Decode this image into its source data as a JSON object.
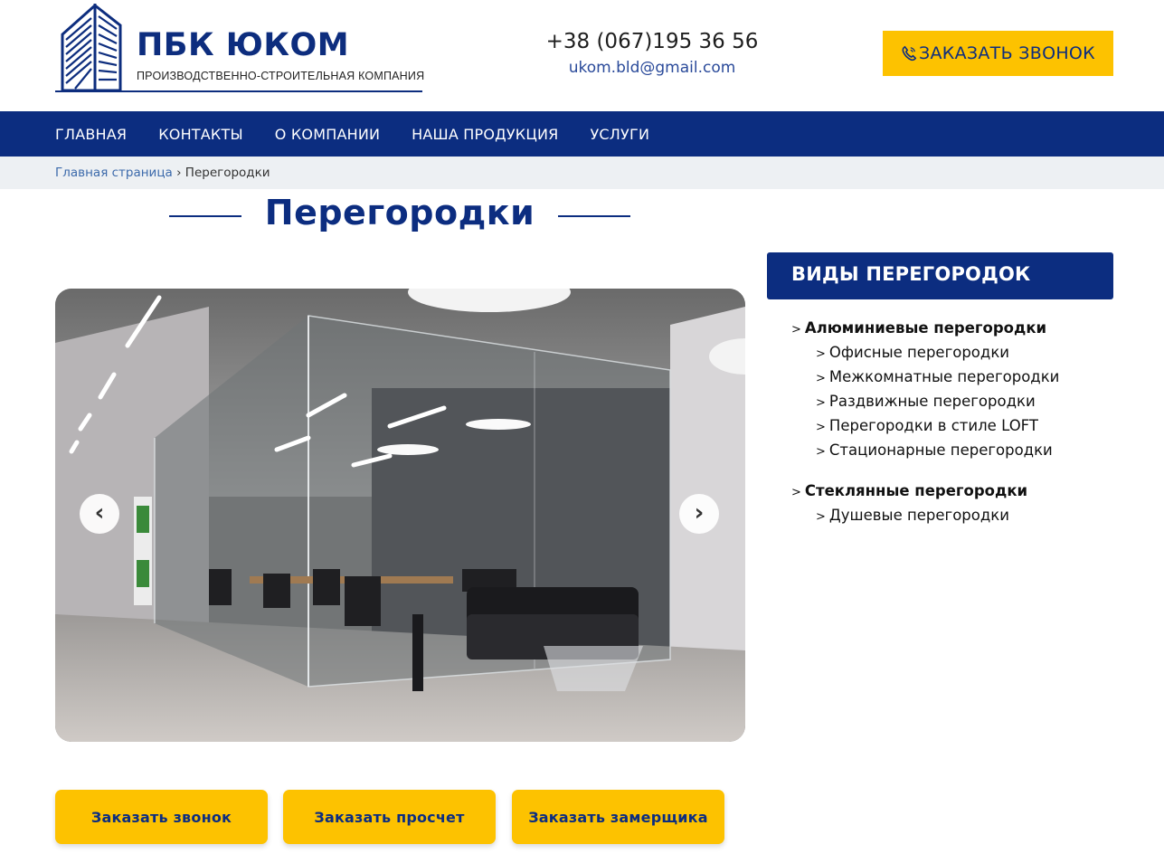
{
  "header": {
    "logo_title": "ПБК ЮКОМ",
    "logo_subtitle": "ПРОИЗВОДСТВЕННО-СТРОИТЕЛЬНАЯ КОМПАНИЯ",
    "phone": "+38 (067)195 36 56",
    "email": "ukom.bld@gmail.com",
    "call_button": "ЗАКАЗАТЬ ЗВОНОК",
    "call_icon": "phone-icon"
  },
  "nav": {
    "items": [
      "ГЛАВНАЯ",
      "КОНТАКТЫ",
      "О КОМПАНИИ",
      "НАША ПРОДУКЦИЯ",
      "УСЛУГИ"
    ]
  },
  "breadcrumb": {
    "home": "Главная страница",
    "separator": "›",
    "current": "Перегородки"
  },
  "page": {
    "title": "Перегородки"
  },
  "slider": {
    "prev_symbol": "‹",
    "next_symbol": "›"
  },
  "actions": {
    "call": "Заказать звонок",
    "estimate": "Заказать просчет",
    "measurer": "Заказать замерщика"
  },
  "sidebar": {
    "heading": "ВИДЫ ПЕРЕГОРОДОК",
    "marker": ">",
    "groups": [
      {
        "title": "Алюминиевые перегородки",
        "items": [
          "Офисные перегородки",
          "Межкомнатные перегородки",
          "Раздвижные перегородки",
          "Перегородки в стиле LOFT",
          "Стационарные перегородки"
        ]
      },
      {
        "title": "Стеклянные перегородки",
        "items": [
          "Душевые перегородки"
        ]
      }
    ]
  },
  "colors": {
    "brand_blue": "#0c2d80",
    "accent_yellow": "#fdc200",
    "crumb_bg": "#edf0f3"
  }
}
